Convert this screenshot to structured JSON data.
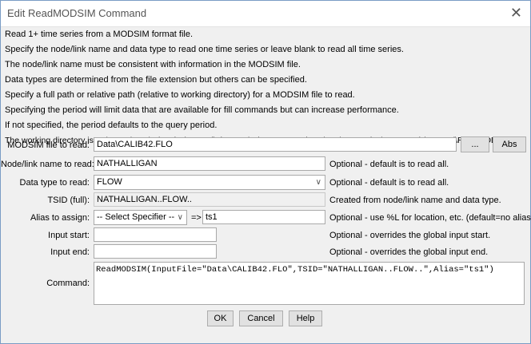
{
  "window": {
    "title": "Edit ReadMODSIM Command",
    "close_glyph": "✕"
  },
  "description": [
    "Read 1+ time series from a MODSIM format file.",
    "Specify the node/link name and data type to read one time series or leave blank to read all time series.",
    "The node/link name must be consistent with information in the MODSIM file.",
    "Data types are determined from the file extension but others can be specified.",
    "Specify a full path or relative path (relative to working directory) for a MODSIM file to read.",
    "Specifying the period will limit data that are available for fill commands but can increase performance.",
    "If not specified, the period defaults to the query period.",
    "The working directory is: C:\\Users\\sam\\cdss-dev\\TSTool\\git-repos\\cdss-app-tstool-test\\test\\regression\\commands\\general\\ReadMODSIM"
  ],
  "form": {
    "file": {
      "label": "MODSIM file to read:",
      "value": "Data\\CALIB42.FLO",
      "browse": "...",
      "abs": "Abs"
    },
    "node": {
      "label": "Node/link name to read:",
      "value": "NATHALLIGAN",
      "note": "Optional - default is to read all."
    },
    "datatype": {
      "label": "Data type to read:",
      "value": "FLOW",
      "note": "Optional - default is to read all."
    },
    "tsid": {
      "label": "TSID (full):",
      "value": "NATHALLIGAN..FLOW..",
      "note": "Created from node/link name and data type."
    },
    "alias": {
      "label": "Alias to assign:",
      "specifier": "-- Select Specifier --",
      "arrow": "=>",
      "value": "ts1",
      "note": "Optional - use %L for location, etc. (default=no alias)."
    },
    "input_start": {
      "label": "Input start:",
      "value": "",
      "note": "Optional - overrides the global input start."
    },
    "input_end": {
      "label": "Input end:",
      "value": "",
      "note": "Optional - overrides the global input end."
    },
    "command": {
      "label": "Command:",
      "value": "ReadMODSIM(InputFile=\"Data\\CALIB42.FLO\",TSID=\"NATHALLIGAN..FLOW..\",Alias=\"ts1\")"
    }
  },
  "buttons": {
    "ok": "OK",
    "cancel": "Cancel",
    "help": "Help"
  }
}
